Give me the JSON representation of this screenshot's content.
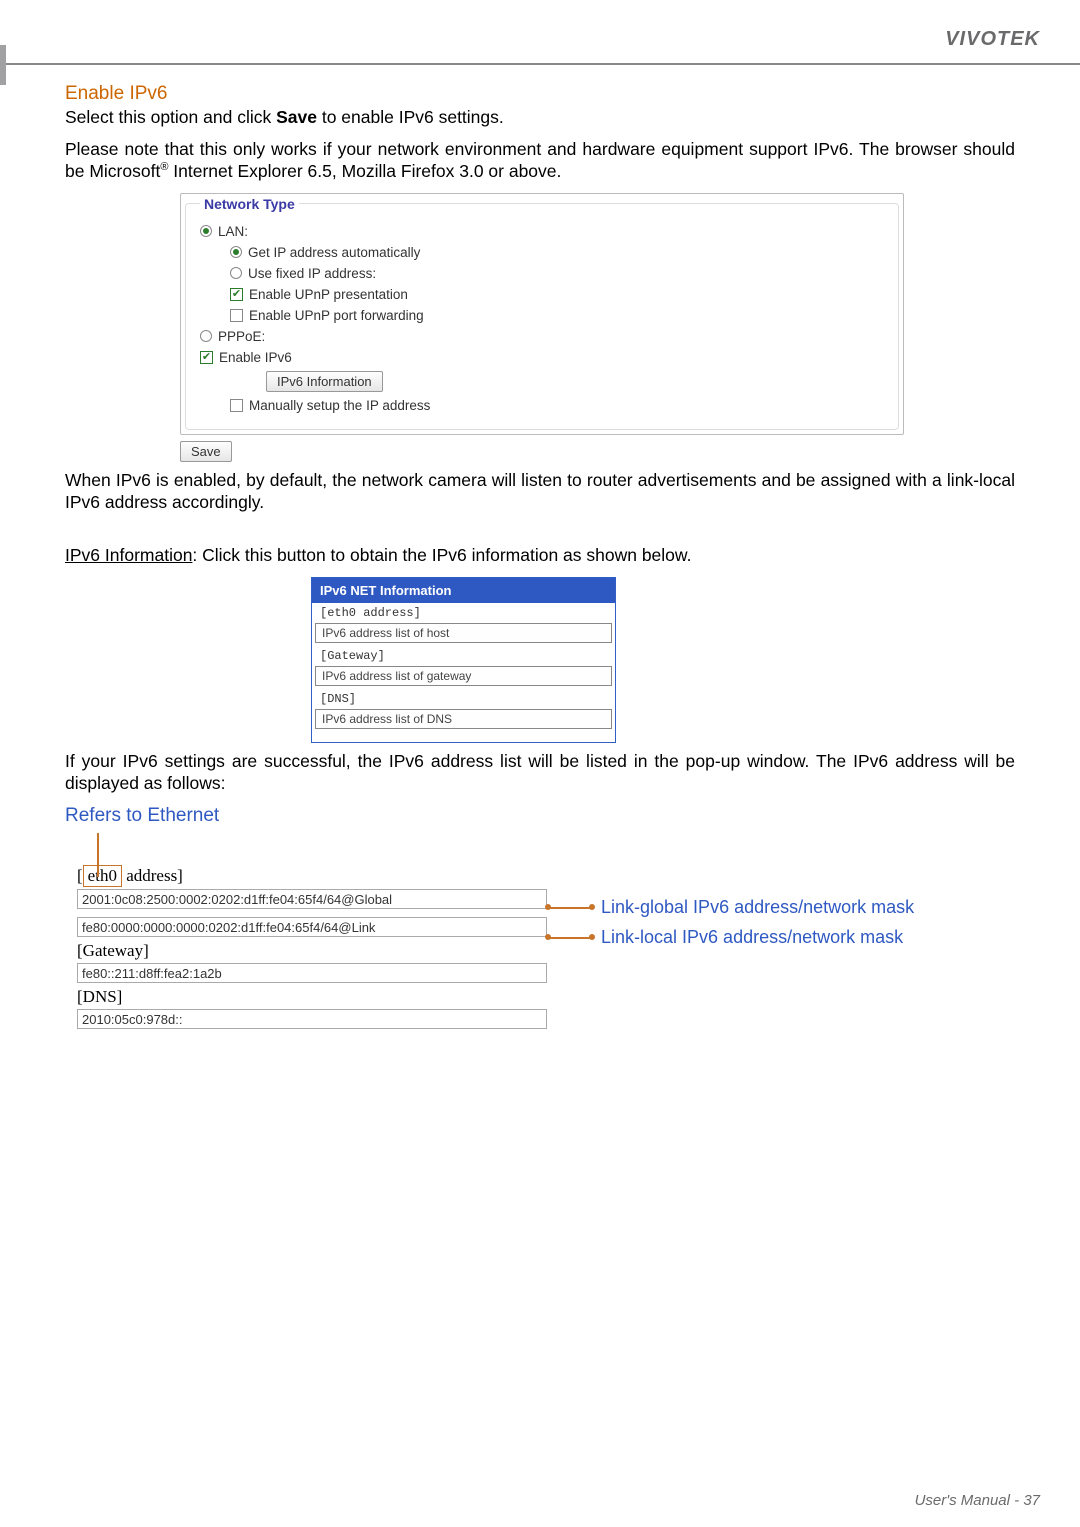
{
  "brand": "VIVOTEK",
  "section1_title": "Enable IPv6",
  "section1_p1_a": "Select this option and click ",
  "section1_p1_bold": "Save",
  "section1_p1_b": " to enable IPv6 settings.",
  "section1_p2_a": "Please note that this only works if your network environment and hardware equipment support IPv6. The browser should be Microsoft",
  "section1_p2_sup": "®",
  "section1_p2_b": " Internet Explorer 6.5, Mozilla Firefox 3.0 or above.",
  "networkType": {
    "legend": "Network Type",
    "lan_label": "LAN:",
    "auto_label": "Get IP address automatically",
    "fixed_label": "Use fixed IP address:",
    "upnp_presentation": "Enable UPnP presentation",
    "upnp_portfwd": "Enable UPnP port forwarding",
    "pppoe_label": "PPPoE:",
    "enable_ipv6_label": "Enable IPv6",
    "ipv6_info_btn": "IPv6 Information",
    "manual_ip_label": "Manually setup the IP address"
  },
  "save_btn": "Save",
  "p_after_ss": "When IPv6 is enabled, by default, the network camera will listen to router advertisements and be assigned with a link-local IPv6 address accordingly.",
  "ipv6info_line_u": "IPv6 Information",
  "ipv6info_line_rest": ": Click this button to obtain the IPv6 information as shown below.",
  "popup": {
    "title": "IPv6 NET Information",
    "eth0": "[eth0 address]",
    "eth0_box": "IPv6 address list of host",
    "gw": "[Gateway]",
    "gw_box": "IPv6 address list of gateway",
    "dns": "[DNS]",
    "dns_box": "IPv6 address list of DNS"
  },
  "p_after_popup": "If your IPv6 settings are successful, the IPv6 address list will be listed in the pop-up window. The IPv6 address will be displayed as follows:",
  "eth": {
    "heading": "Refers to Ethernet",
    "label_eth0_a_pre": "[",
    "label_eth0_inner": "eth0",
    "label_eth0_a_post": " address]",
    "v1": "2001:0c08:2500:0002:0202:d1ff:fe04:65f4/64@Global",
    "v2": "fe80:0000:0000:0000:0202:d1ff:fe04:65f4/64@Link",
    "label_gw": "[Gateway]",
    "v3": "fe80::211:d8ff:fea2:1a2b",
    "label_dns": "[DNS]",
    "v4": "2010:05c0:978d::",
    "annot_global": "Link-global IPv6 address/network mask",
    "annot_local": "Link-local IPv6 address/network mask"
  },
  "footer_a": "User's Manual - ",
  "footer_b": "37"
}
